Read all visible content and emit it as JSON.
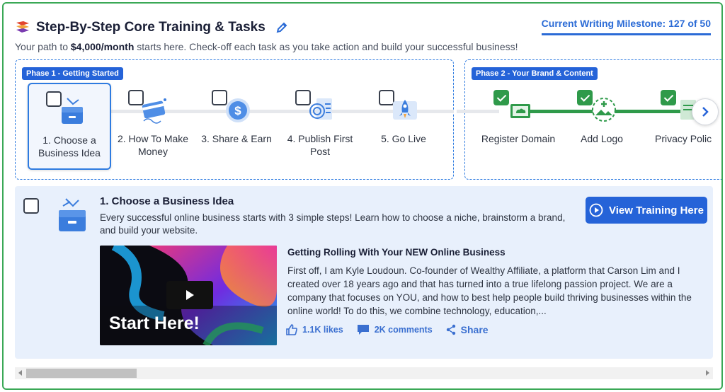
{
  "header": {
    "title": "Step-By-Step Core Training & Tasks",
    "subtitle_prefix": "Your path to ",
    "subtitle_amount": "$4,000/month",
    "subtitle_suffix": " starts here. Check-off each task as you take action and build your successful business!",
    "milestone": "Current Writing Milestone: 127 of 50"
  },
  "phases": [
    {
      "label": "Phase 1 - Getting Started",
      "steps": [
        {
          "label": "1. Choose a Business Idea",
          "checked": false,
          "active": true,
          "icon": "drawer-icon"
        },
        {
          "label": "2. How To Make Money",
          "checked": false,
          "active": false,
          "icon": "credit-card-icon"
        },
        {
          "label": "3. Share & Earn",
          "checked": false,
          "active": false,
          "icon": "dollar-coin-icon"
        },
        {
          "label": "4. Publish First Post",
          "checked": false,
          "active": false,
          "icon": "document-icon"
        },
        {
          "label": "5. Go Live",
          "checked": false,
          "active": false,
          "icon": "rocket-icon"
        }
      ]
    },
    {
      "label": "Phase 2 - Your Brand & Content",
      "steps": [
        {
          "label": "Register Domain",
          "checked": true,
          "icon": "domain-icon"
        },
        {
          "label": "Add Logo",
          "checked": true,
          "icon": "logo-upload-icon"
        },
        {
          "label": "Privacy Polic",
          "checked": true,
          "icon": "privacy-doc-icon"
        }
      ]
    }
  ],
  "detail": {
    "title": "1. Choose a Business Idea",
    "description": "Every successful online business starts with 3 simple steps! Learn how to choose a niche, brainstorm a brand, and build your website.",
    "training_button": "View Training Here",
    "video_caption": "Start Here!",
    "post_title": "Getting Rolling With Your NEW Online Business",
    "post_body": "First off, I am Kyle Loudoun. Co-founder of Wealthy Affiliate, a platform that Carson Lim and I created over 18 years ago and that has turned into a true lifelong passion project. We are a company that focuses on YOU, and how to best help people build thriving businesses within the online world! To do this, we combine technology, education,...",
    "likes": "1.1K likes",
    "comments": "2K comments",
    "share": "Share"
  },
  "colors": {
    "accent": "#2563d8",
    "success": "#2f9a4a",
    "frame": "#3aa856",
    "panel": "#e8f0fc"
  }
}
